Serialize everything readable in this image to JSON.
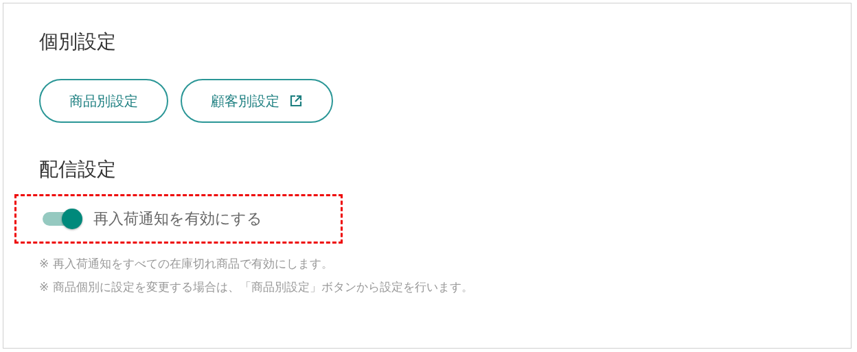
{
  "sections": [
    {
      "title": "個別設定",
      "buttons": [
        {
          "label": "商品別設定",
          "external": false
        },
        {
          "label": "顧客別設定",
          "external": true
        }
      ]
    },
    {
      "title": "配信設定",
      "toggle": {
        "label": "再入荷通知を有効にする",
        "on": true,
        "highlighted": true
      },
      "notes": [
        "※ 再入荷通知をすべての在庫切れ商品で有効にします。",
        "※ 商品個別に設定を変更する場合は、「商品別設定」ボタンから設定を行います。"
      ]
    }
  ]
}
